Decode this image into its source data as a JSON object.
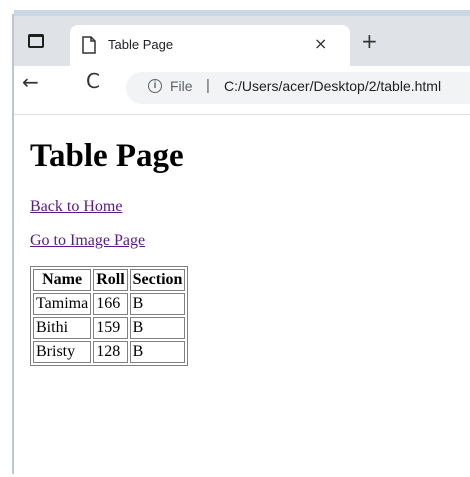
{
  "browser": {
    "tab_title": "Table Page",
    "tab_close": "×",
    "new_tab": "+",
    "back": "←",
    "reload": "C",
    "info_icon": "i",
    "file_label": "File",
    "separator": "|",
    "url": "C:/Users/acer/Desktop/2/table.html"
  },
  "page": {
    "heading": "Table Page",
    "links": [
      "Back to Home",
      "Go to Image Page"
    ],
    "table": {
      "headers": [
        "Name",
        "Roll",
        "Section"
      ],
      "rows": [
        [
          "Tamima",
          "166",
          "B"
        ],
        [
          "Bithi",
          "159",
          "B"
        ],
        [
          "Bristy",
          "128",
          "B"
        ]
      ]
    }
  }
}
